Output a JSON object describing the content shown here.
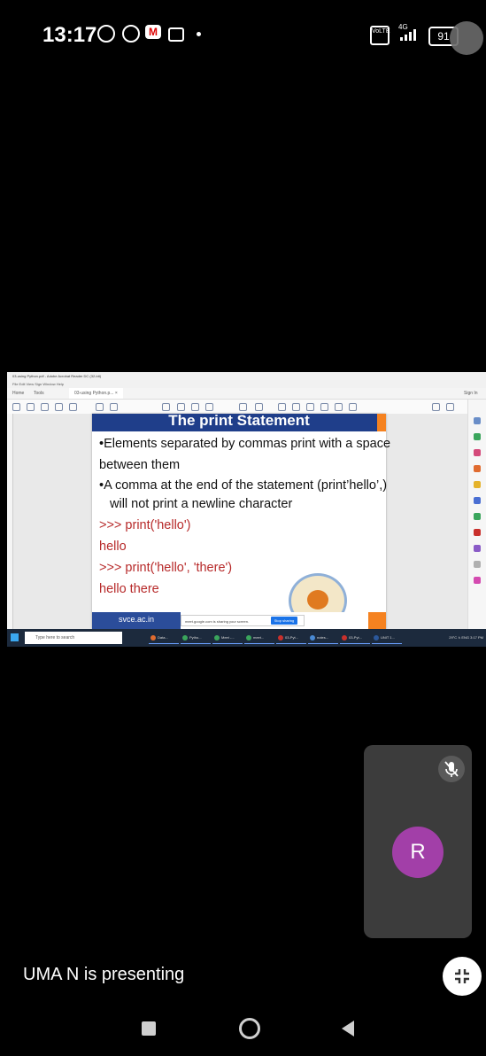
{
  "status_bar": {
    "time": "13:17",
    "battery": "91",
    "network": "4G",
    "volte": "VoLTE"
  },
  "shared_screen": {
    "window_title": "03-using Python.pdf - Adobe Acrobat Reader DC (32-bit)",
    "menu": "File   Edit   View   Sign   Window   Help",
    "tabs": [
      "Home",
      "Tools",
      "03-using Python.p... ×"
    ],
    "sign_in": "Sign In",
    "slide": {
      "title": "The print Statement",
      "lines": [
        "•Elements separated by commas print with a space",
        "between them",
        "•A comma at the end of the statement (print’hello’,)",
        "  will not print a newline character"
      ],
      "code": [
        ">>> print('hello')",
        "hello",
        ">>> print('hello', 'there')",
        "hello there"
      ],
      "footer_site": "svce.ac.in"
    },
    "share_notice": "meet.google.com is sharing your screen.",
    "stop_sharing": "Stop sharing",
    "hide": "Hide",
    "taskbar": {
      "search_placeholder": "Type here to search",
      "apps": [
        "Data...",
        "Pytho...",
        "Meet -...",
        "meet...",
        "03-Pyt...",
        "notes...",
        "03-Pyt...",
        "UNIT 1..."
      ],
      "tray": "29°C  ∧  ENG  3:17 PM"
    }
  },
  "participant": {
    "initial": "R",
    "avatar_color": "#a23fa8"
  },
  "presenting_label": "UMA N is presenting"
}
